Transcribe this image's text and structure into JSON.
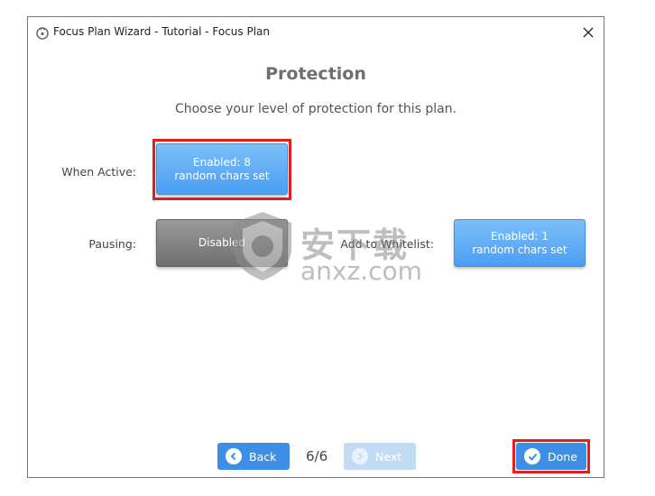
{
  "window": {
    "title": "Focus Plan Wizard - Tutorial - Focus Plan"
  },
  "page": {
    "heading": "Protection",
    "subtitle": "Choose your level of protection for this plan."
  },
  "options": {
    "when_active": {
      "label": "When Active:",
      "button_line1": "Enabled: 8",
      "button_line2": "random chars set"
    },
    "pausing": {
      "label": "Pausing:",
      "button": "Disabled"
    },
    "whitelist": {
      "label": "Add to Whitelist:",
      "button_line1": "Enabled: 1",
      "button_line2": "random chars set"
    }
  },
  "nav": {
    "back": "Back",
    "page_indicator": "6/6",
    "next": "Next",
    "done": "Done"
  },
  "watermark": {
    "chars": "安下载",
    "domain": "anxz.com"
  },
  "colors": {
    "accent_blue": "#4a9ef3",
    "disabled_grey": "#6f6f6f",
    "highlight_red": "#e02020"
  }
}
